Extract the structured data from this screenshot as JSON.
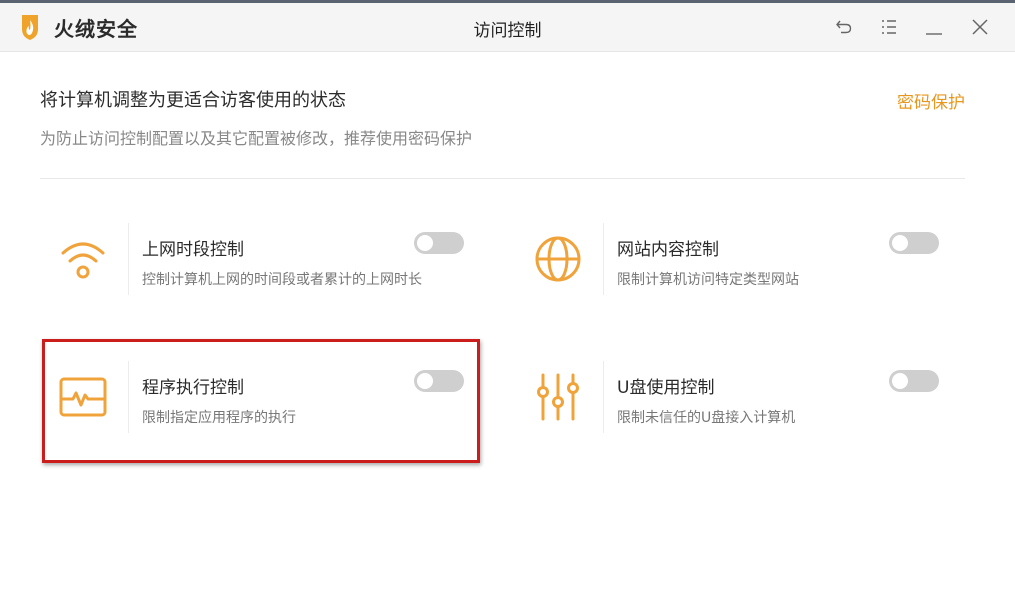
{
  "app": {
    "brand_name": "火绒安全",
    "window_title": "访问控制",
    "accent_color": "#e8971e",
    "icons": [
      "fire-logo-icon",
      "back-icon",
      "menu-icon",
      "minimize-icon",
      "close-icon"
    ]
  },
  "header": {
    "title": "将计算机调整为更适合访客使用的状态",
    "subtitle": "为防止访问控制配置以及其它配置被修改，推荐使用密码保护",
    "password_link": "密码保护"
  },
  "features": [
    {
      "title": "上网时段控制",
      "desc": "控制计算机上网的时间段或者累计的上网时长",
      "icon": "wifi-icon",
      "enabled": false
    },
    {
      "title": "网站内容控制",
      "desc": "限制计算机访问特定类型网站",
      "icon": "globe-icon",
      "enabled": false
    },
    {
      "title": "程序执行控制",
      "desc": "限制指定应用程序的执行",
      "icon": "monitor-pulse-icon",
      "enabled": false,
      "highlighted": true
    },
    {
      "title": "U盘使用控制",
      "desc": "限制未信任的U盘接入计算机",
      "icon": "sliders-icon",
      "enabled": false
    }
  ]
}
